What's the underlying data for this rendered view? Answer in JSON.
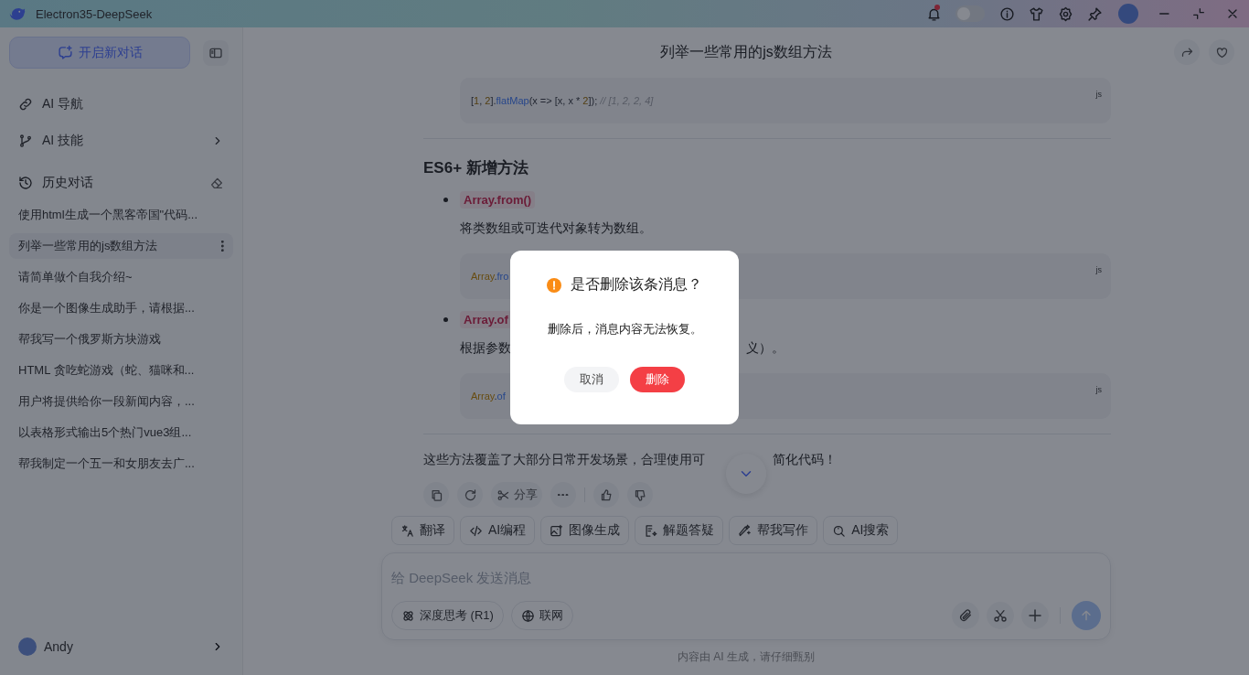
{
  "window": {
    "title": "Electron35-DeepSeek"
  },
  "titlebar": {
    "notification_dot": true,
    "toggle": {
      "on": false
    }
  },
  "sidebar": {
    "new_chat": "开启新对话",
    "nav": [
      {
        "label": "AI 导航",
        "kind": "link"
      },
      {
        "label": "AI 技能",
        "kind": "expand"
      }
    ],
    "history_title": "历史对话",
    "history": [
      {
        "title": "使用html生成一个黑客帝国\"代码...",
        "selected": false
      },
      {
        "title": "列举一些常用的js数组方法",
        "selected": true
      },
      {
        "title": "请简单做个自我介绍~",
        "selected": false
      },
      {
        "title": "你是一个图像生成助手，请根据...",
        "selected": false
      },
      {
        "title": "帮我写一个俄罗斯方块游戏",
        "selected": false
      },
      {
        "title": "HTML 贪吃蛇游戏（蛇、猫咪和...",
        "selected": false
      },
      {
        "title": "用户将提供给你一段新闻内容，...",
        "selected": false
      },
      {
        "title": "以表格形式输出5个热门vue3组...",
        "selected": false
      },
      {
        "title": "帮我制定一个五一和女朋友去广...",
        "selected": false
      }
    ],
    "user": {
      "name": "Andy"
    }
  },
  "chat": {
    "title": "列举一些常用的js数组方法",
    "content": [
      {
        "kind": "code",
        "lang": "js",
        "tokens": [
          {
            "text": "[",
            "kind": "plain"
          },
          {
            "text": "1",
            "kind": "number"
          },
          {
            "text": ", ",
            "kind": "plain"
          },
          {
            "text": "2",
            "kind": "number"
          },
          {
            "text": "].",
            "kind": "plain"
          },
          {
            "text": "flatMap",
            "kind": "func"
          },
          {
            "text": "(x => [x, x * ",
            "kind": "plain"
          },
          {
            "text": "2",
            "kind": "number"
          },
          {
            "text": "]); ",
            "kind": "plain"
          },
          {
            "text": "// [1, 2, 2, 4]",
            "kind": "comment"
          }
        ]
      },
      {
        "kind": "rule"
      },
      {
        "kind": "heading",
        "text": "ES6+ 新增方法"
      },
      {
        "kind": "bullet",
        "code": "Array.from()"
      },
      {
        "kind": "desc",
        "parts": [
          "将类数组或可迭代对象转为数组。"
        ]
      },
      {
        "kind": "code",
        "lang": "js",
        "tokens": [
          {
            "text": "Array",
            "kind": "class"
          },
          {
            "text": ".",
            "kind": "plain"
          },
          {
            "text": "fro",
            "kind": "func"
          }
        ]
      },
      {
        "kind": "bullet",
        "code": "Array.of"
      },
      {
        "kind": "desc",
        "parts": [
          "根据参数",
          "义）。"
        ]
      },
      {
        "kind": "code",
        "lang": "js",
        "tokens": [
          {
            "text": "Array",
            "kind": "class"
          },
          {
            "text": ".",
            "kind": "plain"
          },
          {
            "text": "of",
            "kind": "func"
          }
        ]
      },
      {
        "kind": "rule"
      },
      {
        "kind": "paragraph",
        "parts": [
          "这些方法覆盖了大部分日常开发场景，合理使用可",
          "简化代码！"
        ]
      }
    ],
    "actions": [
      {
        "kind": "copy"
      },
      {
        "kind": "refresh"
      },
      {
        "kind": "share",
        "label": "分享"
      },
      {
        "kind": "more"
      },
      {
        "kind": "divider"
      },
      {
        "kind": "like"
      },
      {
        "kind": "dislike"
      }
    ],
    "tools": [
      {
        "kind": "translate",
        "label": "翻译"
      },
      {
        "kind": "code",
        "label": "AI编程"
      },
      {
        "kind": "image",
        "label": "图像生成"
      },
      {
        "kind": "solve",
        "label": "解题答疑"
      },
      {
        "kind": "write",
        "label": "帮我写作"
      },
      {
        "kind": "search",
        "label": "AI搜索"
      }
    ],
    "input": {
      "placeholder": "给 DeepSeek 发送消息"
    },
    "chips": [
      {
        "kind": "think",
        "label": "深度思考 (R1)",
        "selected": false
      },
      {
        "kind": "web",
        "label": "联网",
        "selected": false
      }
    ],
    "footer": "内容由 AI 生成，请仔细甄别"
  },
  "dialog": {
    "title": "是否删除该条消息？",
    "message": "删除后，消息内容无法恢复。",
    "buttons": [
      {
        "label": "取消",
        "kind": "cancel"
      },
      {
        "label": "删除",
        "kind": "danger"
      }
    ]
  }
}
